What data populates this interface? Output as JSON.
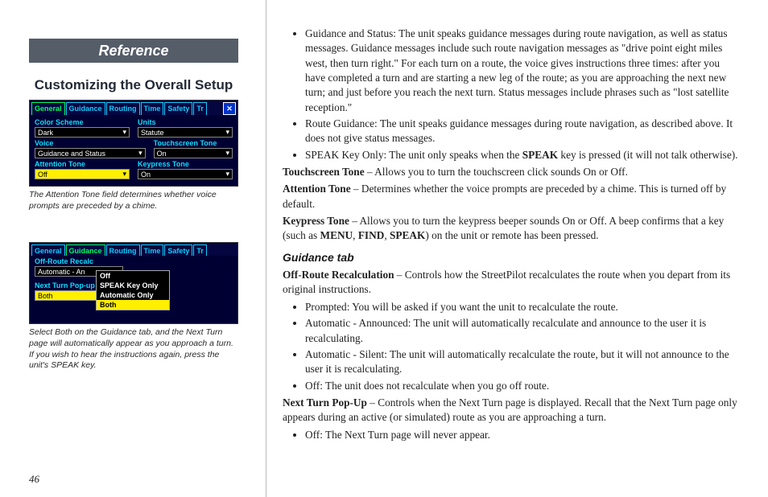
{
  "page_number": "46",
  "header_band": "Reference",
  "left_heading": "Customizing the Overall Setup",
  "shot1": {
    "tabs": [
      "General",
      "Guidance",
      "Routing",
      "Time",
      "Safety",
      "Tr"
    ],
    "active_tab_index": 0,
    "close_glyph": "✕",
    "fields": {
      "color_scheme_label": "Color Scheme",
      "color_scheme_value": "Dark",
      "units_label": "Units",
      "units_value": "Statute",
      "voice_label": "Voice",
      "voice_value": "Guidance and Status",
      "touchscreen_tone_label": "Touchscreen Tone",
      "touchscreen_tone_value": "On",
      "attention_tone_label": "Attention Tone",
      "attention_tone_value": "Off",
      "keypress_tone_label": "Keypress Tone",
      "keypress_tone_value": "On"
    }
  },
  "caption1": "The Attention Tone field determines whether voice prompts are preceded by a chime.",
  "shot2": {
    "tabs": [
      "General",
      "Guidance",
      "Routing",
      "Time",
      "Safety",
      "Tr"
    ],
    "active_tab_index": 1,
    "off_route_label": "Off-Route Recalc",
    "off_route_value": "Automatic - An",
    "next_turn_label": "Next Turn Pop-up",
    "next_turn_value": "Both",
    "popup_options": [
      "Off",
      "SPEAK Key Only",
      "Automatic Only",
      "Both"
    ],
    "popup_highlight_index": 3
  },
  "caption2": "Select Both on the Guidance tab, and the Next Turn page will automatically appear as you approach a turn. If you wish to hear the instructions again, press the unit's SPEAK key.",
  "right": {
    "bullets_top": [
      {
        "lead": "Guidance and Status: ",
        "text": "The unit speaks guidance messages during route navigation, as well as status messages. Guidance messages include such route navigation messages as \"drive point eight miles west, then turn right.\" For each turn on a route, the voice gives instructions three times: after you have completed a turn and are starting a new leg of the route; as you are approaching the next new turn; and just before you reach the next turn. Status messages include phrases such as \"lost satellite reception.\""
      },
      {
        "lead": "Route Guidance: ",
        "text": "The unit speaks guidance messages during route navigation, as described above. It does not give status messages."
      },
      {
        "lead": "SPEAK Key Only: ",
        "text_before_bold": "The unit only speaks when the ",
        "bold": "SPEAK",
        "text_after_bold": " key is pressed (it will not talk otherwise)."
      }
    ],
    "touchscreen_tone": {
      "label": "Touchscreen Tone",
      "text": " – Allows you to turn the touchscreen click sounds On or Off."
    },
    "attention_tone": {
      "label": "Attention Tone",
      "text": " – Determines whether the voice prompts are preceded by a chime. This is turned off by default."
    },
    "keypress_tone": {
      "label": "Keypress Tone",
      "pre": " – Allows you to turn the keypress beeper sounds On or Off. A beep confirms that a key (such as ",
      "k1": "MENU",
      "sep1": ", ",
      "k2": "FIND",
      "sep2": ", ",
      "k3": "SPEAK",
      "post": ") on the unit or remote has been pressed."
    },
    "guidance_tab_heading": "Guidance tab",
    "off_route_recalc": {
      "label": "Off-Route Recalculation",
      "text": " – Controls how the StreetPilot recalculates the route when you depart from its original instructions."
    },
    "recalc_bullets": [
      "Prompted: You will be asked if you want the unit to recalculate the route.",
      "Automatic - Announced: The unit will automatically recalculate and announce to the user it is recalculating.",
      "Automatic - Silent: The unit will automatically recalculate the route, but it will not announce to the user it is recalculating.",
      "Off: The unit does not recalculate when you go off route."
    ],
    "next_turn_popup": {
      "label": "Next Turn Pop-Up",
      "text": " – Controls when the Next Turn page is displayed. Recall that the Next Turn page only appears during an active (or simulated) route as you are approaching a turn."
    },
    "nt_bullets": [
      "Off: The Next Turn page will never appear."
    ]
  }
}
